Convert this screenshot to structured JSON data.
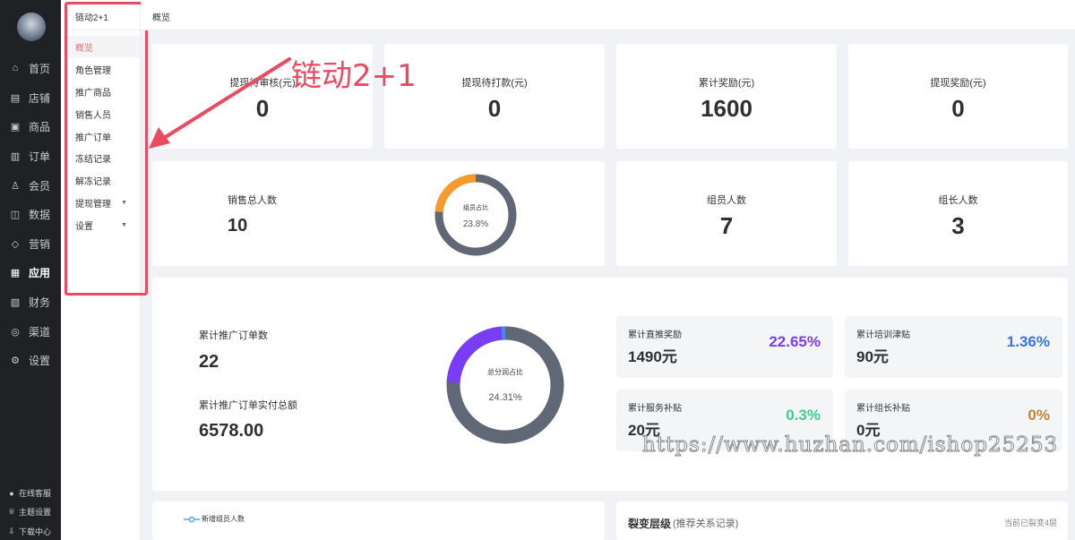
{
  "sidebar": {
    "items": [
      {
        "label": "首页",
        "icon": "home-icon",
        "glyph": "⌂"
      },
      {
        "label": "店铺",
        "icon": "store-icon",
        "glyph": "▤"
      },
      {
        "label": "商品",
        "icon": "goods-icon",
        "glyph": "▣"
      },
      {
        "label": "订单",
        "icon": "order-icon",
        "glyph": "▥"
      },
      {
        "label": "会员",
        "icon": "member-icon",
        "glyph": "♙"
      },
      {
        "label": "数据",
        "icon": "data-icon",
        "glyph": "◫"
      },
      {
        "label": "营销",
        "icon": "marketing-tag-icon",
        "glyph": "◇"
      },
      {
        "label": "应用",
        "icon": "app-icon",
        "glyph": "▦"
      },
      {
        "label": "财务",
        "icon": "finance-icon",
        "glyph": "▧"
      },
      {
        "label": "渠道",
        "icon": "channel-icon",
        "glyph": "◎"
      },
      {
        "label": "设置",
        "icon": "settings-gear-icon",
        "glyph": "⚙"
      }
    ],
    "active_index": 7,
    "bottom": [
      {
        "label": "在线客服",
        "icon": "customer-service-icon",
        "glyph": "●"
      },
      {
        "label": "主题设置",
        "icon": "theme-shirt-icon",
        "glyph": "♕"
      },
      {
        "label": "下载中心",
        "icon": "download-icon",
        "glyph": "⇩"
      }
    ]
  },
  "submenu": {
    "title": "链动2+1",
    "items": [
      {
        "label": "概览",
        "active": true
      },
      {
        "label": "角色管理"
      },
      {
        "label": "推广商品"
      },
      {
        "label": "销售人员"
      },
      {
        "label": "推广订单"
      },
      {
        "label": "冻结记录"
      },
      {
        "label": "解冻记录"
      },
      {
        "label": "提现管理",
        "has_caret": true
      },
      {
        "label": "设置",
        "has_caret": true
      }
    ]
  },
  "header": {
    "breadcrumb": "概览"
  },
  "stats_row1": [
    {
      "label": "提现待审核(元)",
      "value": "0"
    },
    {
      "label": "提现待打款(元)",
      "value": "0"
    },
    {
      "label": "累计奖励(元)",
      "value": "1600"
    },
    {
      "label": "提现奖励(元)",
      "value": "0"
    }
  ],
  "members": {
    "total_label": "销售总人数",
    "total_value": "10",
    "donut": {
      "label": "组员占比",
      "value_text": "23.8%",
      "fraction": 0.238,
      "color_main": "#5f6874",
      "color_part": "#f79a2e"
    },
    "member_label": "组员人数",
    "member_value": "7",
    "leader_label": "组长人数",
    "leader_value": "3"
  },
  "orders": {
    "count_label": "累计推广订单数",
    "count_value": "22",
    "amount_label": "累计推广订单实付总额",
    "amount_value": "6578.00",
    "donut": {
      "label": "总分润占比",
      "value_text": "24.31%",
      "fraction": 0.2431,
      "color_main": "#5f6874",
      "color_part": "#7b3cf5",
      "color_accent": "#3b8cff"
    },
    "mini_cards": [
      {
        "label": "累计直推奖励",
        "amount": "1490元",
        "pct": "22.65%",
        "color": "#7b3cf5"
      },
      {
        "label": "累计培训津贴",
        "amount": "90元",
        "pct": "1.36%",
        "color": "#3b73e8"
      },
      {
        "label": "累计服务补贴",
        "amount": "20元",
        "pct": "0.3%",
        "color": "#3ccf8e"
      },
      {
        "label": "累计组长补贴",
        "amount": "0元",
        "pct": "0%",
        "color": "#c1843a"
      }
    ]
  },
  "bottom_left": {
    "legend": "新增组员人数",
    "legend_color": "#4aa8ff"
  },
  "bottom_right": {
    "title": "裂变层级",
    "subtitle": "(推荐关系记录)",
    "right_text": "当前已裂变4层"
  },
  "annotation": {
    "text": "链动2+1",
    "color": "#ea4b60"
  },
  "watermark": {
    "text": "https://www.huzhan.com/ishop25253"
  }
}
